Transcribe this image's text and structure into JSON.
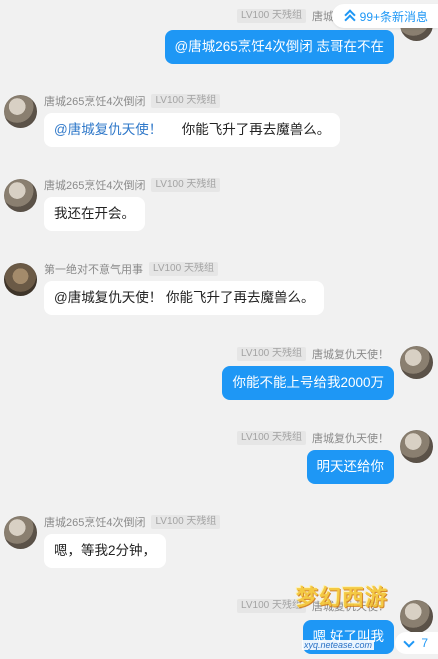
{
  "new_messages": {
    "label": "99+条新消息",
    "icon": "double-chevron-up-icon"
  },
  "messages": [
    {
      "side": "right",
      "nick": "唐城复仇天使！",
      "level": "LV100 天残组",
      "text": "@唐城265烹饪4次倒闭 志哥在不在"
    },
    {
      "side": "left",
      "nick": "唐城265烹饪4次倒闭",
      "level": "LV100 天残组",
      "mention": "@唐城复仇天使！",
      "text": "你能飞升了再去魔兽么。"
    },
    {
      "side": "left",
      "nick": "唐城265烹饪4次倒闭",
      "level": "LV100 天残组",
      "text": "我还在开会。"
    },
    {
      "side": "left",
      "nick": "第一绝对不意气用事",
      "level": "LV100 天残组",
      "text": "@唐城复仇天使！  你能飞升了再去魔兽么。"
    },
    {
      "side": "right",
      "nick": "唐城复仇天使！",
      "level": "LV100 天残组",
      "text": "你能不能上号给我2000万"
    },
    {
      "side": "right",
      "nick": "唐城复仇天使！",
      "level": "LV100 天残组",
      "text": "明天还给你"
    },
    {
      "side": "left",
      "nick": "唐城265烹饪4次倒闭",
      "level": "LV100 天残组",
      "text": "嗯，等我2分钟，"
    },
    {
      "side": "right",
      "nick": "唐城复仇天使！",
      "level": "LV100 天残组",
      "text": "嗯 好了叫我"
    }
  ],
  "unread_bottom": {
    "count": "7",
    "icon": "chevron-down-icon"
  },
  "watermark": {
    "title": "梦幻西游",
    "url": "xyq.netease.com"
  },
  "colors": {
    "accent": "#1e97f5",
    "background": "#f1f1f1",
    "bubble_left": "#ffffff"
  }
}
